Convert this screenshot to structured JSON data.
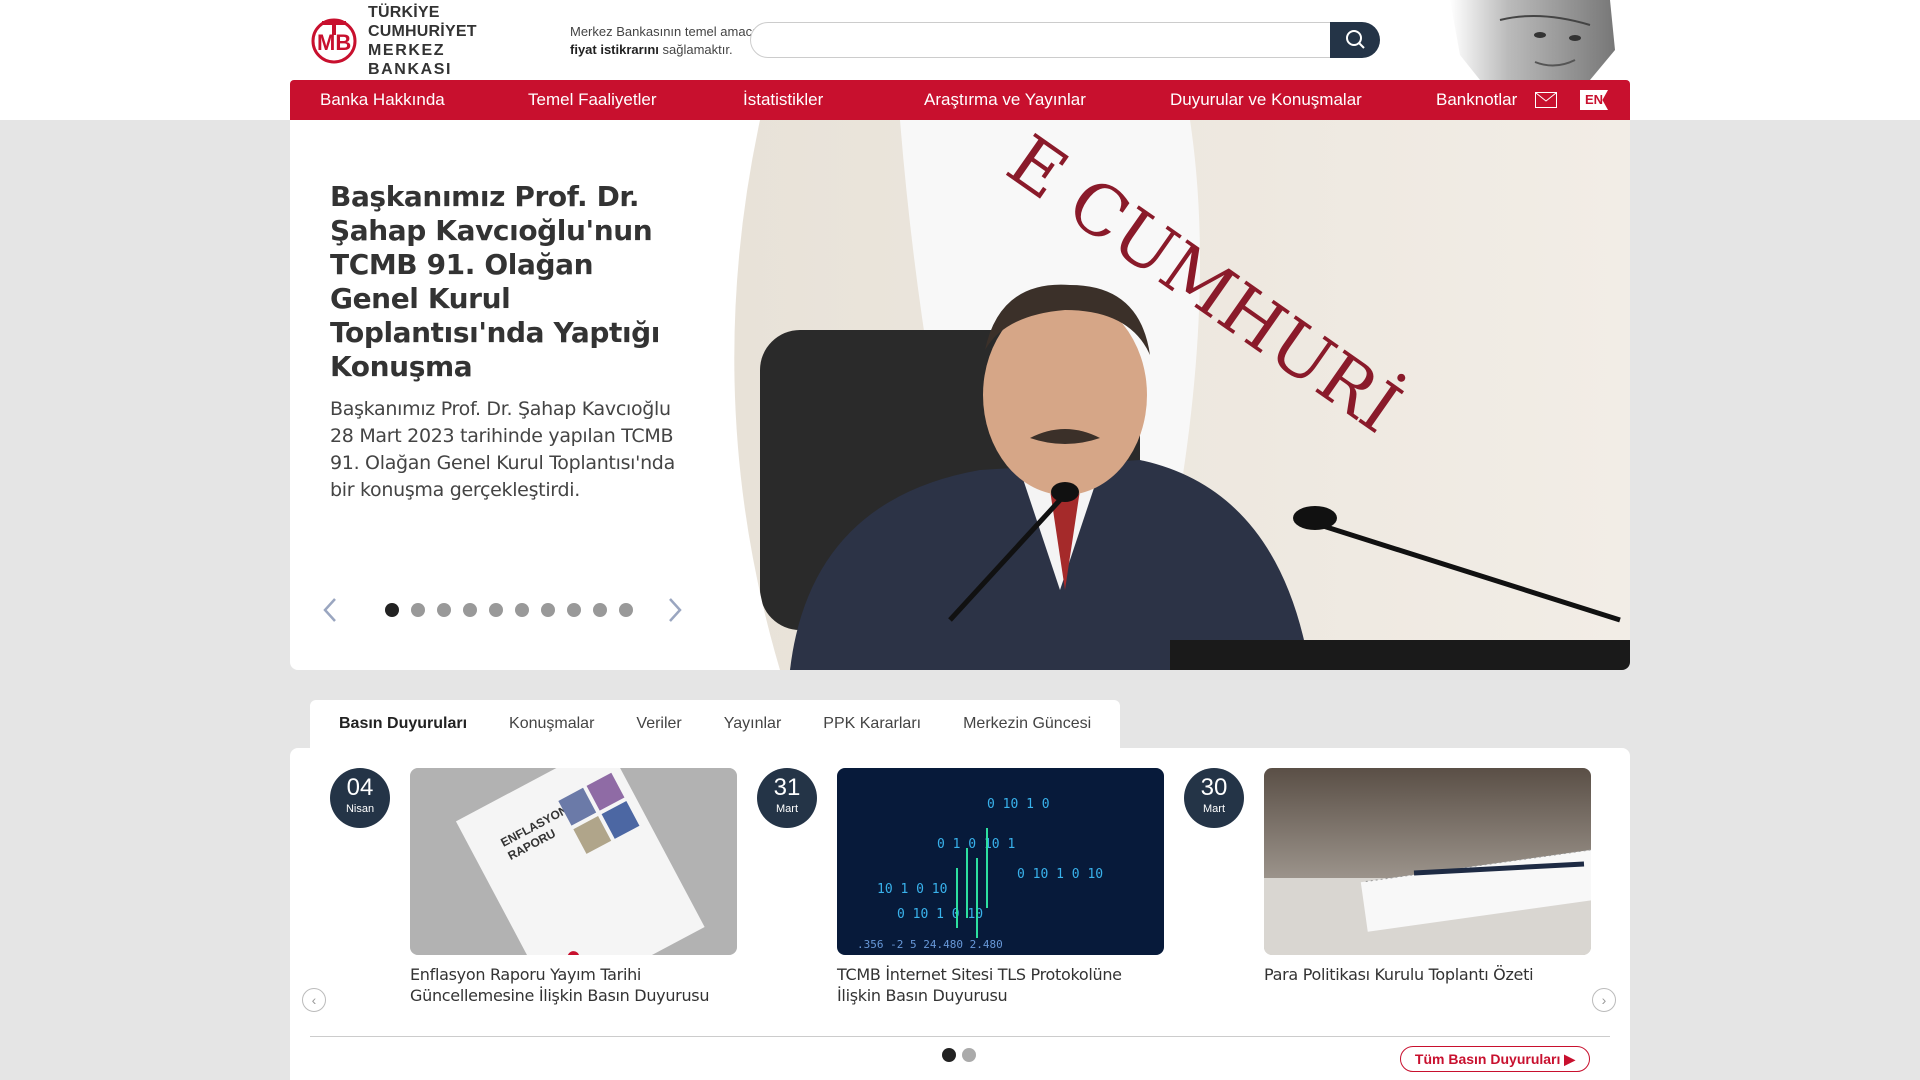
{
  "header": {
    "logo": {
      "line1": "TÜRKİYE CUMHURİYET",
      "line2": "MERKEZ BANKASI"
    },
    "motto": {
      "line1": "Merkez Bankasının temel amacı",
      "bold": "fiyat istikrarını",
      "line2_rest": " sağlamaktır."
    },
    "search": {
      "placeholder": "",
      "icon": "search-icon"
    }
  },
  "nav": {
    "items": [
      {
        "label": "Banka Hakkında"
      },
      {
        "label": "Temel Faaliyetler"
      },
      {
        "label": "İstatistikler"
      },
      {
        "label": "Araştırma ve Yayınlar"
      },
      {
        "label": "Duyurular ve Konuşmalar"
      },
      {
        "label": "Banknotlar"
      }
    ],
    "mail_icon": "mail-icon",
    "lang": "EN"
  },
  "hero": {
    "title": "Başkanımız Prof. Dr. Şahap Kavcıoğlu'nun TCMB 91. Olağan Genel Kurul Toplantısı'nda Yaptığı Konuşma",
    "description": "Başkanımız Prof. Dr. Şahap Kavcıoğlu 28 Mart 2023 tarihinde yapılan TCMB 91. Olağan Genel Kurul Toplantısı'nda bir konuşma gerçekleştirdi.",
    "slide_count": 10,
    "active_slide": 1
  },
  "tabs": [
    {
      "label": "Basın Duyuruları",
      "active": true
    },
    {
      "label": "Konuşmalar",
      "active": false
    },
    {
      "label": "Veriler",
      "active": false
    },
    {
      "label": "Yayınlar",
      "active": false
    },
    {
      "label": "PPK Kararları",
      "active": false
    },
    {
      "label": "Merkezin Güncesi",
      "active": false
    }
  ],
  "news": {
    "items": [
      {
        "day": "04",
        "month": "Nisan",
        "title": "Enflasyon Raporu Yayım Tarihi Güncellemesine İlişkin Basın Duyurusu"
      },
      {
        "day": "31",
        "month": "Mart",
        "title": "TCMB İnternet Sitesi TLS Protokolüne İlişkin Basın Duyurusu"
      },
      {
        "day": "30",
        "month": "Mart",
        "title": "Para Politikası Kurulu Toplantı Özeti"
      }
    ],
    "page_count": 2,
    "active_page": 1,
    "all_button": "Tüm Basın Duyuruları"
  },
  "colors": {
    "brand_red": "#c8102e",
    "navy": "#243447"
  }
}
